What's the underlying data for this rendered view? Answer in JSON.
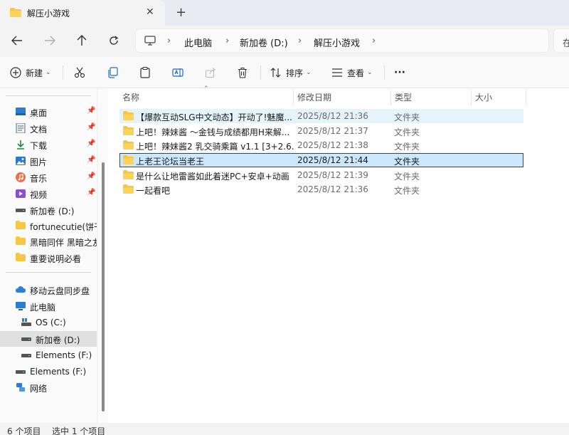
{
  "tab": {
    "title": "解压小游戏",
    "close": "✕",
    "new_tab": "+"
  },
  "breadcrumb": [
    "此电脑",
    "新加卷 (D:)",
    "解压小游戏"
  ],
  "search_fragment": "在",
  "toolbar": {
    "new_label": "新建",
    "sort_label": "排序",
    "view_label": "查看",
    "more": "···"
  },
  "sidebar": {
    "quick_access": [
      {
        "label": "桌面",
        "icon": "desktop-icon",
        "color": "#2b7cd3"
      },
      {
        "label": "文档",
        "icon": "documents-icon",
        "color": "#5a6a7a"
      },
      {
        "label": "下载",
        "icon": "download-icon",
        "color": "#1e8a3f"
      },
      {
        "label": "图片",
        "icon": "pictures-icon",
        "color": "#2a78d0"
      },
      {
        "label": "音乐",
        "icon": "music-icon",
        "color": "#e8734a"
      },
      {
        "label": "视频",
        "icon": "videos-icon",
        "color": "#8a4fd0"
      }
    ],
    "folders": [
      {
        "label": "新加卷 (D:)",
        "icon": "drive-icon"
      },
      {
        "label": "fortunecutie(饼干",
        "icon": "folder-icon"
      },
      {
        "label": "黑暗同伴 黑暗之友",
        "icon": "folder-icon"
      },
      {
        "label": "重要说明必看",
        "icon": "folder-icon"
      }
    ],
    "cloud": {
      "label": "移动云盘同步盘",
      "icon": "cloud-icon"
    },
    "this_pc": {
      "label": "此电脑",
      "icon": "pc-icon"
    },
    "drives": [
      {
        "label": "OS (C:)",
        "icon": "drive-icon"
      },
      {
        "label": "新加卷 (D:)",
        "icon": "drive-icon",
        "selected": true
      },
      {
        "label": "Elements (F:)",
        "icon": "drive-icon"
      }
    ],
    "external": {
      "label": "Elements (F:)",
      "icon": "drive-icon"
    },
    "network": {
      "label": "网络",
      "icon": "network-icon"
    }
  },
  "columns": {
    "name": "名称",
    "date": "修改日期",
    "type": "类型",
    "size": "大小"
  },
  "files": [
    {
      "name": "【爆款互动SLG中文动态】开动了!魅魔...",
      "date": "2025/8/12 21:36",
      "type": "文件夹",
      "state": "hover"
    },
    {
      "name": "上吧！辣妹酱 ～金钱与成绩都用H来解...",
      "date": "2025/8/12 21:37",
      "type": "文件夹",
      "state": ""
    },
    {
      "name": "上吧！辣妹酱2 乳交骑乘篇 v1.1 [3+2.6...",
      "date": "2025/8/12 21:38",
      "type": "文件夹",
      "state": ""
    },
    {
      "name": "上老王论坛当老王",
      "date": "2025/8/12 21:44",
      "type": "文件夹",
      "state": "selected"
    },
    {
      "name": "是什么让地雷酱如此着迷PC+安卓+动画",
      "date": "2025/8/12 21:39",
      "type": "文件夹",
      "state": ""
    },
    {
      "name": "一起看吧",
      "date": "2025/8/12 21:36",
      "type": "文件夹",
      "state": ""
    }
  ],
  "status": {
    "count": "6 个项目",
    "selected": "选中 1 个项目"
  },
  "colors": {
    "folder": "#f8c640",
    "folder_dark": "#e6a817",
    "selection": "#cce8ff",
    "hover": "#e5f3fb"
  }
}
